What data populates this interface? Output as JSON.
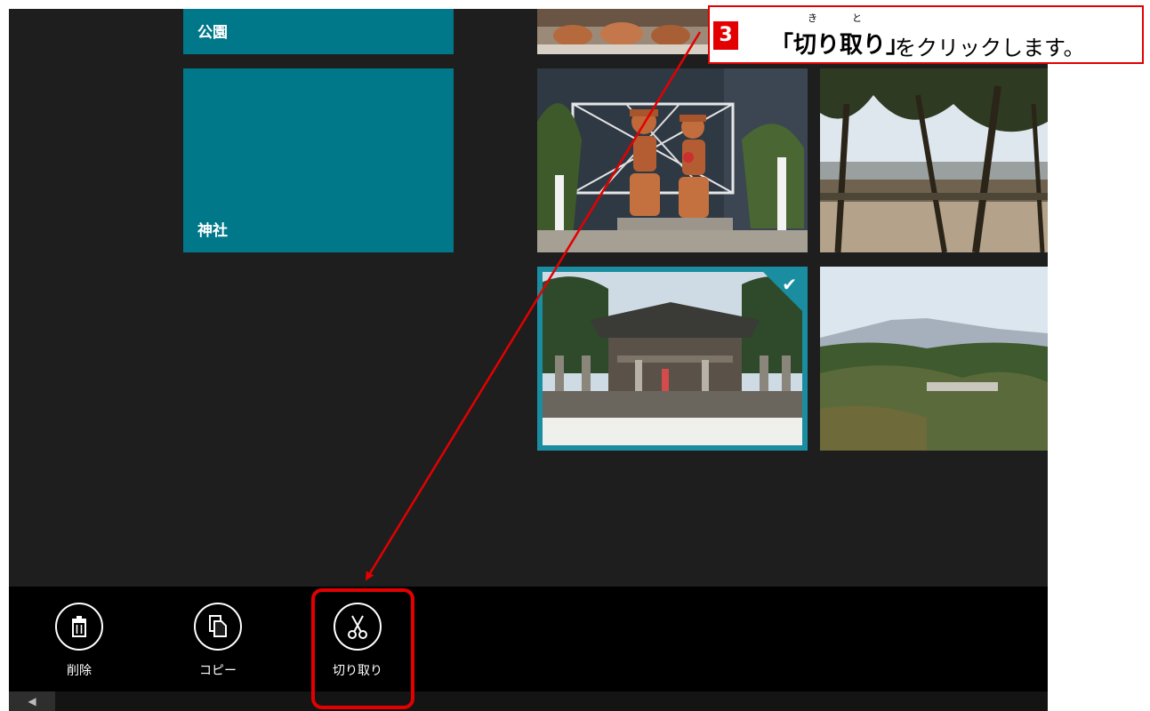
{
  "folders": [
    {
      "label": "公園"
    },
    {
      "label": "神社"
    }
  ],
  "appbar": {
    "commands": [
      {
        "label": "削除",
        "icon": "trash-icon"
      },
      {
        "label": "コピー",
        "icon": "copy-icon"
      },
      {
        "label": "切り取り",
        "icon": "scissors-icon"
      }
    ]
  },
  "callout": {
    "step": "3",
    "bold_text": "「切り取り」",
    "rest_text": "をクリックします。",
    "ruby_ki": "き",
    "ruby_to": "と"
  },
  "colors": {
    "folder_tile": "#00788a",
    "selection": "#1a8ea0",
    "annotation": "#e30000"
  }
}
